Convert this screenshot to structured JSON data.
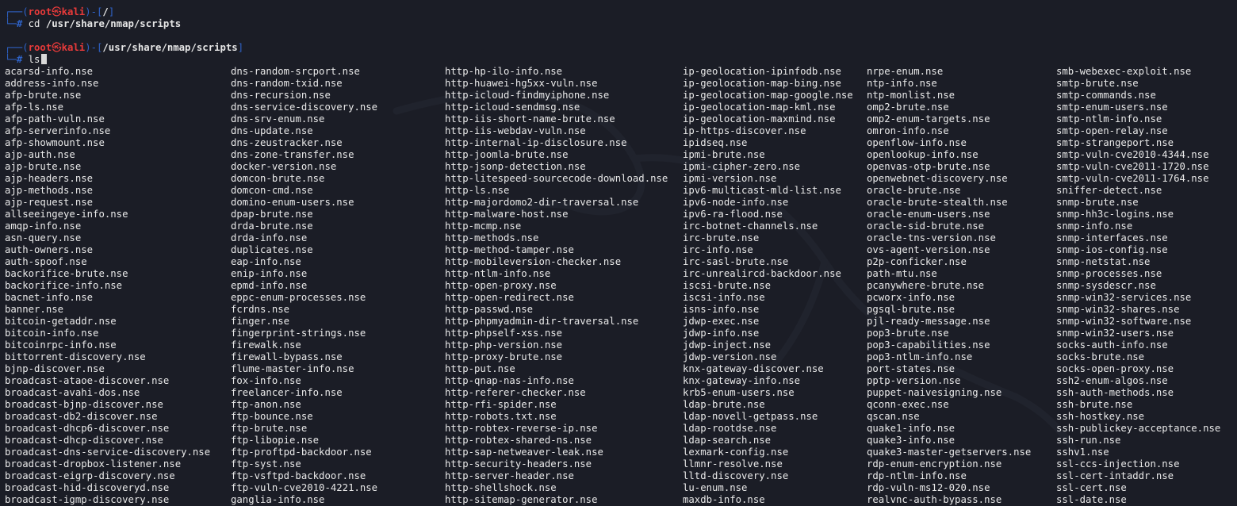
{
  "prompt1": {
    "user": "root",
    "skull": "㉿",
    "host": "kali",
    "cwd": "/",
    "command_name": "cd",
    "command_arg": "/usr/share/nmap/scripts"
  },
  "prompt2": {
    "user": "root",
    "skull": "㉿",
    "host": "kali",
    "cwd": "/usr/share/nmap/scripts",
    "command_name": "ls"
  },
  "prompt_symbols": {
    "top_corner": "┌──",
    "bottom_corner": "└─",
    "hash": "#",
    "open_paren": "(",
    "close_paren": ")-[",
    "close_bracket": "]"
  },
  "listing": {
    "col1": [
      "acarsd-info.nse",
      "address-info.nse",
      "afp-brute.nse",
      "afp-ls.nse",
      "afp-path-vuln.nse",
      "afp-serverinfo.nse",
      "afp-showmount.nse",
      "ajp-auth.nse",
      "ajp-brute.nse",
      "ajp-headers.nse",
      "ajp-methods.nse",
      "ajp-request.nse",
      "allseeingeye-info.nse",
      "amqp-info.nse",
      "asn-query.nse",
      "auth-owners.nse",
      "auth-spoof.nse",
      "backorifice-brute.nse",
      "backorifice-info.nse",
      "bacnet-info.nse",
      "banner.nse",
      "bitcoin-getaddr.nse",
      "bitcoin-info.nse",
      "bitcoinrpc-info.nse",
      "bittorrent-discovery.nse",
      "bjnp-discover.nse",
      "broadcast-ataoe-discover.nse",
      "broadcast-avahi-dos.nse",
      "broadcast-bjnp-discover.nse",
      "broadcast-db2-discover.nse",
      "broadcast-dhcp6-discover.nse",
      "broadcast-dhcp-discover.nse",
      "broadcast-dns-service-discovery.nse",
      "broadcast-dropbox-listener.nse",
      "broadcast-eigrp-discovery.nse",
      "broadcast-hid-discoveryd.nse",
      "broadcast-igmp-discovery.nse"
    ],
    "col2": [
      "dns-random-srcport.nse",
      "dns-random-txid.nse",
      "dns-recursion.nse",
      "dns-service-discovery.nse",
      "dns-srv-enum.nse",
      "dns-update.nse",
      "dns-zeustracker.nse",
      "dns-zone-transfer.nse",
      "docker-version.nse",
      "domcon-brute.nse",
      "domcon-cmd.nse",
      "domino-enum-users.nse",
      "dpap-brute.nse",
      "drda-brute.nse",
      "drda-info.nse",
      "duplicates.nse",
      "eap-info.nse",
      "enip-info.nse",
      "epmd-info.nse",
      "eppc-enum-processes.nse",
      "fcrdns.nse",
      "finger.nse",
      "fingerprint-strings.nse",
      "firewalk.nse",
      "firewall-bypass.nse",
      "flume-master-info.nse",
      "fox-info.nse",
      "freelancer-info.nse",
      "ftp-anon.nse",
      "ftp-bounce.nse",
      "ftp-brute.nse",
      "ftp-libopie.nse",
      "ftp-proftpd-backdoor.nse",
      "ftp-syst.nse",
      "ftp-vsftpd-backdoor.nse",
      "ftp-vuln-cve2010-4221.nse",
      "ganglia-info.nse"
    ],
    "col3": [
      "http-hp-ilo-info.nse",
      "http-huawei-hg5xx-vuln.nse",
      "http-icloud-findmyiphone.nse",
      "http-icloud-sendmsg.nse",
      "http-iis-short-name-brute.nse",
      "http-iis-webdav-vuln.nse",
      "http-internal-ip-disclosure.nse",
      "http-joomla-brute.nse",
      "http-jsonp-detection.nse",
      "http-litespeed-sourcecode-download.nse",
      "http-ls.nse",
      "http-majordomo2-dir-traversal.nse",
      "http-malware-host.nse",
      "http-mcmp.nse",
      "http-methods.nse",
      "http-method-tamper.nse",
      "http-mobileversion-checker.nse",
      "http-ntlm-info.nse",
      "http-open-proxy.nse",
      "http-open-redirect.nse",
      "http-passwd.nse",
      "http-phpmyadmin-dir-traversal.nse",
      "http-phpself-xss.nse",
      "http-php-version.nse",
      "http-proxy-brute.nse",
      "http-put.nse",
      "http-qnap-nas-info.nse",
      "http-referer-checker.nse",
      "http-rfi-spider.nse",
      "http-robots.txt.nse",
      "http-robtex-reverse-ip.nse",
      "http-robtex-shared-ns.nse",
      "http-sap-netweaver-leak.nse",
      "http-security-headers.nse",
      "http-server-header.nse",
      "http-shellshock.nse",
      "http-sitemap-generator.nse"
    ],
    "col4": [
      "ip-geolocation-ipinfodb.nse",
      "ip-geolocation-map-bing.nse",
      "ip-geolocation-map-google.nse",
      "ip-geolocation-map-kml.nse",
      "ip-geolocation-maxmind.nse",
      "ip-https-discover.nse",
      "ipidseq.nse",
      "ipmi-brute.nse",
      "ipmi-cipher-zero.nse",
      "ipmi-version.nse",
      "ipv6-multicast-mld-list.nse",
      "ipv6-node-info.nse",
      "ipv6-ra-flood.nse",
      "irc-botnet-channels.nse",
      "irc-brute.nse",
      "irc-info.nse",
      "irc-sasl-brute.nse",
      "irc-unrealircd-backdoor.nse",
      "iscsi-brute.nse",
      "iscsi-info.nse",
      "isns-info.nse",
      "jdwp-exec.nse",
      "jdwp-info.nse",
      "jdwp-inject.nse",
      "jdwp-version.nse",
      "knx-gateway-discover.nse",
      "knx-gateway-info.nse",
      "krb5-enum-users.nse",
      "ldap-brute.nse",
      "ldap-novell-getpass.nse",
      "ldap-rootdse.nse",
      "ldap-search.nse",
      "lexmark-config.nse",
      "llmnr-resolve.nse",
      "lltd-discovery.nse",
      "lu-enum.nse",
      "maxdb-info.nse"
    ],
    "col5": [
      "nrpe-enum.nse",
      "ntp-info.nse",
      "ntp-monlist.nse",
      "omp2-brute.nse",
      "omp2-enum-targets.nse",
      "omron-info.nse",
      "openflow-info.nse",
      "openlookup-info.nse",
      "openvas-otp-brute.nse",
      "openwebnet-discovery.nse",
      "oracle-brute.nse",
      "oracle-brute-stealth.nse",
      "oracle-enum-users.nse",
      "oracle-sid-brute.nse",
      "oracle-tns-version.nse",
      "ovs-agent-version.nse",
      "p2p-conficker.nse",
      "path-mtu.nse",
      "pcanywhere-brute.nse",
      "pcworx-info.nse",
      "pgsql-brute.nse",
      "pjl-ready-message.nse",
      "pop3-brute.nse",
      "pop3-capabilities.nse",
      "pop3-ntlm-info.nse",
      "port-states.nse",
      "pptp-version.nse",
      "puppet-naivesigning.nse",
      "qconn-exec.nse",
      "qscan.nse",
      "quake1-info.nse",
      "quake3-info.nse",
      "quake3-master-getservers.nse",
      "rdp-enum-encryption.nse",
      "rdp-ntlm-info.nse",
      "rdp-vuln-ms12-020.nse",
      "realvnc-auth-bypass.nse"
    ],
    "col6": [
      "smb-webexec-exploit.nse",
      "smtp-brute.nse",
      "smtp-commands.nse",
      "smtp-enum-users.nse",
      "smtp-ntlm-info.nse",
      "smtp-open-relay.nse",
      "smtp-strangeport.nse",
      "smtp-vuln-cve2010-4344.nse",
      "smtp-vuln-cve2011-1720.nse",
      "smtp-vuln-cve2011-1764.nse",
      "sniffer-detect.nse",
      "snmp-brute.nse",
      "snmp-hh3c-logins.nse",
      "snmp-info.nse",
      "snmp-interfaces.nse",
      "snmp-ios-config.nse",
      "snmp-netstat.nse",
      "snmp-processes.nse",
      "snmp-sysdescr.nse",
      "snmp-win32-services.nse",
      "snmp-win32-shares.nse",
      "snmp-win32-software.nse",
      "snmp-win32-users.nse",
      "socks-auth-info.nse",
      "socks-brute.nse",
      "socks-open-proxy.nse",
      "ssh2-enum-algos.nse",
      "ssh-auth-methods.nse",
      "ssh-brute.nse",
      "ssh-hostkey.nse",
      "ssh-publickey-acceptance.nse",
      "ssh-run.nse",
      "sshv1.nse",
      "ssl-ccs-injection.nse",
      "ssl-cert-intaddr.nse",
      "ssl-cert.nse",
      "ssl-date.nse"
    ]
  },
  "colors": {
    "background": "#1b1d26",
    "prompt_blue": "#2f63c8",
    "prompt_red": "#e83a3a",
    "text": "#e9e9e9"
  },
  "background_icon": "kali-dragon-watermark-icon"
}
